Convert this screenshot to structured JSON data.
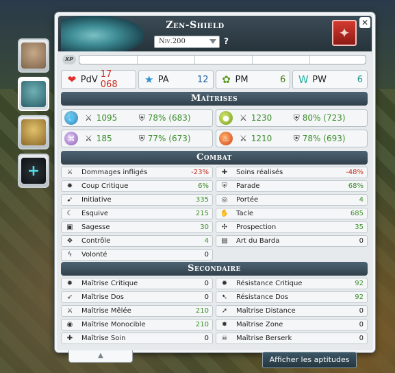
{
  "character": {
    "name": "Zen-Shield",
    "level": "Niv.200",
    "help": "?"
  },
  "xp": {
    "badge": "XP"
  },
  "resources": [
    {
      "label": "PdV",
      "value": "17 068",
      "icon": "heart-icon"
    },
    {
      "label": "PA",
      "value": "12",
      "icon": "star-icon"
    },
    {
      "label": "PM",
      "value": "6",
      "icon": "boot-icon"
    },
    {
      "label": "PW",
      "value": "6",
      "icon": "wakfu-icon"
    }
  ],
  "sections": {
    "maitrises": "Maîtrises",
    "combat": "Combat",
    "secondaire": "Secondaire"
  },
  "masteries": [
    {
      "element": "water",
      "mastery": "1095",
      "resist": "78% (683)"
    },
    {
      "element": "earth",
      "mastery": "1230",
      "resist": "80% (723)"
    },
    {
      "element": "air",
      "mastery": "185",
      "resist": "77% (673)"
    },
    {
      "element": "fire",
      "mastery": "1210",
      "resist": "78% (693)"
    }
  ],
  "combat": [
    {
      "label": "Dommages infligés",
      "value": "-23%",
      "color": "red",
      "icon": "sword-icon"
    },
    {
      "label": "Soins réalisés",
      "value": "-48%",
      "color": "red",
      "icon": "heal-icon"
    },
    {
      "label": "Coup Critique",
      "value": "6%",
      "color": "green",
      "icon": "critical-icon"
    },
    {
      "label": "Parade",
      "value": "68%",
      "color": "green",
      "icon": "parry-icon"
    },
    {
      "label": "Initiative",
      "value": "335",
      "color": "green",
      "icon": "initiative-icon"
    },
    {
      "label": "Portée",
      "value": "4",
      "color": "green",
      "icon": "range-icon"
    },
    {
      "label": "Esquive",
      "value": "215",
      "color": "green",
      "icon": "dodge-icon"
    },
    {
      "label": "Tacle",
      "value": "685",
      "color": "green",
      "icon": "lock-icon"
    },
    {
      "label": "Sagesse",
      "value": "30",
      "color": "green",
      "icon": "wisdom-icon"
    },
    {
      "label": "Prospection",
      "value": "35",
      "color": "green",
      "icon": "prospecting-icon"
    },
    {
      "label": "Contrôle",
      "value": "4",
      "color": "green",
      "icon": "control-icon"
    },
    {
      "label": "Art du Barda",
      "value": "0",
      "color": "black",
      "icon": "kit-skill-icon"
    },
    {
      "label": "Volonté",
      "value": "0",
      "color": "black",
      "icon": "willpower-icon"
    }
  ],
  "secondary": [
    {
      "label": "Maîtrise Critique",
      "value": "0",
      "color": "black",
      "icon": "critical-mastery-icon"
    },
    {
      "label": "Résistance Critique",
      "value": "92",
      "color": "green",
      "icon": "critical-resist-icon"
    },
    {
      "label": "Maîtrise Dos",
      "value": "0",
      "color": "black",
      "icon": "rear-mastery-icon"
    },
    {
      "label": "Résistance Dos",
      "value": "92",
      "color": "green",
      "icon": "rear-resist-icon"
    },
    {
      "label": "Maîtrise Mêlée",
      "value": "210",
      "color": "green",
      "icon": "melee-mastery-icon"
    },
    {
      "label": "Maîtrise Distance",
      "value": "0",
      "color": "black",
      "icon": "distance-mastery-icon"
    },
    {
      "label": "Maîtrise Monocible",
      "value": "210",
      "color": "green",
      "icon": "single-target-icon"
    },
    {
      "label": "Maîtrise Zone",
      "value": "0",
      "color": "black",
      "icon": "area-mastery-icon"
    },
    {
      "label": "Maîtrise Soin",
      "value": "0",
      "color": "black",
      "icon": "heal-mastery-icon"
    },
    {
      "label": "Maîtrise Berserk",
      "value": "0",
      "color": "black",
      "icon": "berserk-mastery-icon"
    }
  ],
  "buttons": {
    "aptitudes": "Afficher les aptitudes",
    "expand": "▲"
  }
}
